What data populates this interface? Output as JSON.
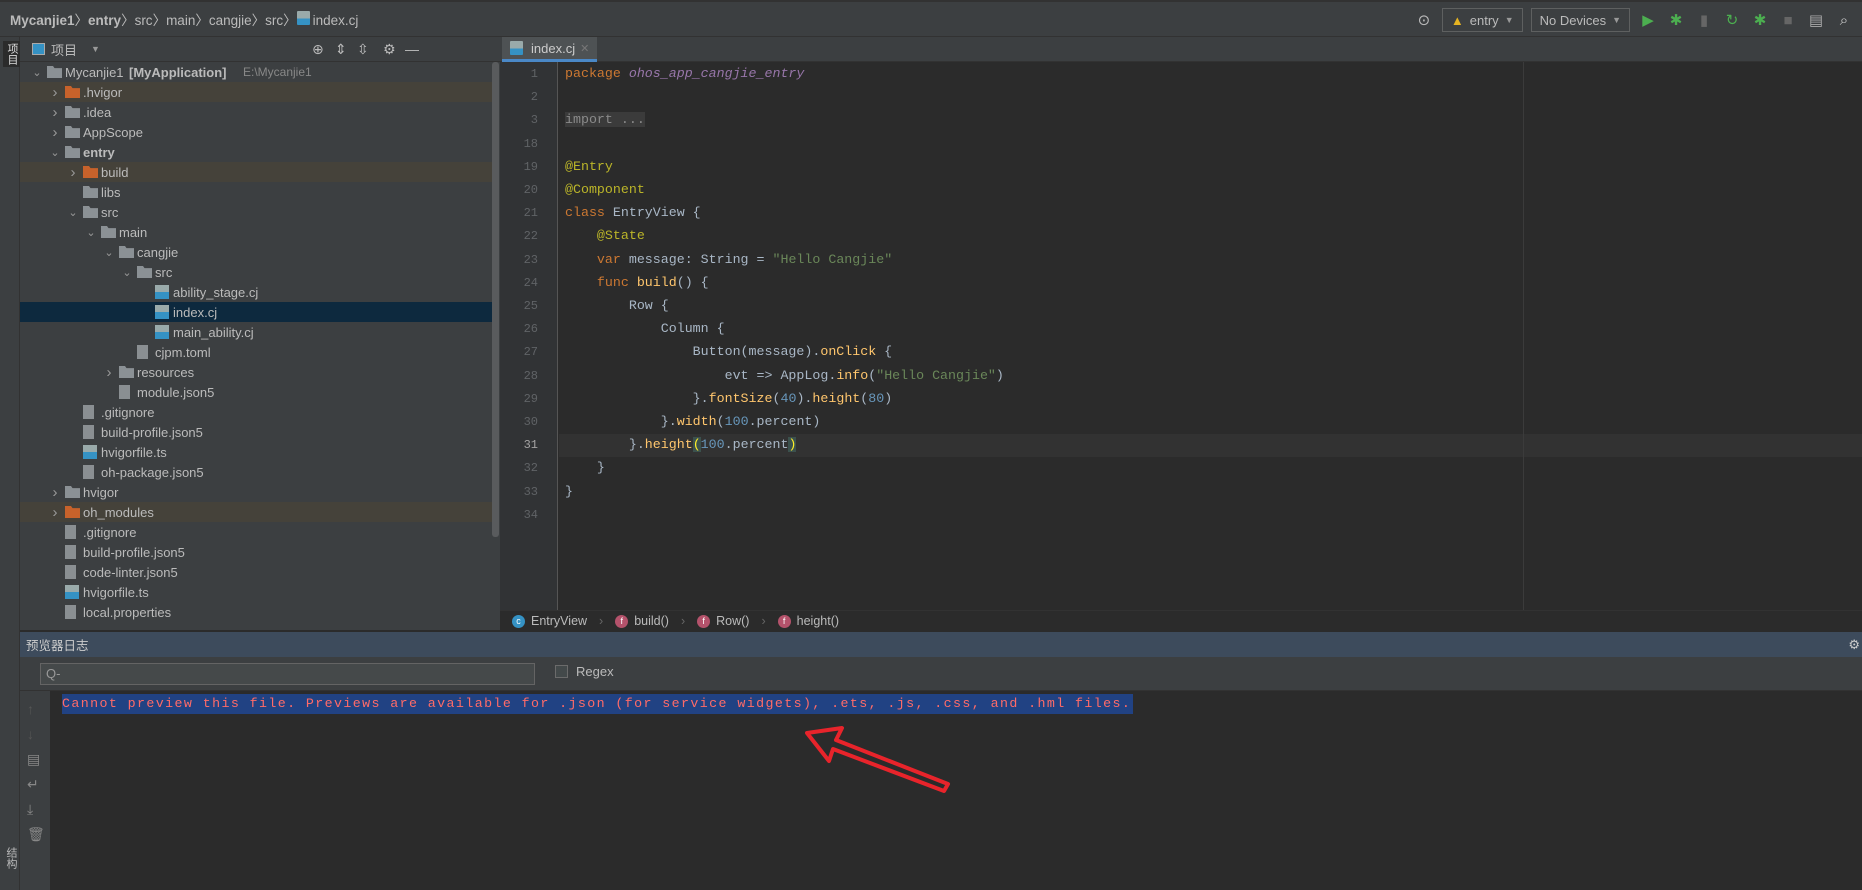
{
  "breadcrumb": [
    "Mycanjie1",
    "entry",
    "src",
    "main",
    "cangjie",
    "src",
    "index.cj"
  ],
  "toolbar": {
    "config": "entry",
    "devices": "No Devices"
  },
  "leftstrip": {
    "project": "项目",
    "structure": "结构"
  },
  "project_panel": {
    "title": "项目"
  },
  "tree": [
    {
      "label": "Mycanjie1",
      "bold": "[MyApplication]",
      "path": "E:\\Mycanjie1",
      "level": 0,
      "type": "module",
      "expanded": true
    },
    {
      "label": ".hvigor",
      "level": 1,
      "type": "folder-orange",
      "expanded": false,
      "excluded": true
    },
    {
      "label": ".idea",
      "level": 1,
      "type": "folder",
      "expanded": false
    },
    {
      "label": "AppScope",
      "level": 1,
      "type": "folder",
      "expanded": false
    },
    {
      "label": "entry",
      "level": 1,
      "type": "module",
      "expanded": true,
      "boldlabel": true
    },
    {
      "label": "build",
      "level": 2,
      "type": "folder-orange",
      "expanded": false,
      "excluded": true
    },
    {
      "label": "libs",
      "level": 2,
      "type": "folder"
    },
    {
      "label": "src",
      "level": 2,
      "type": "folder",
      "expanded": true
    },
    {
      "label": "main",
      "level": 3,
      "type": "folder",
      "expanded": true
    },
    {
      "label": "cangjie",
      "level": 4,
      "type": "folder",
      "expanded": true
    },
    {
      "label": "src",
      "level": 5,
      "type": "folder",
      "expanded": true
    },
    {
      "label": "ability_stage.cj",
      "level": 6,
      "type": "cj"
    },
    {
      "label": "index.cj",
      "level": 6,
      "type": "cj",
      "selected": true
    },
    {
      "label": "main_ability.cj",
      "level": 6,
      "type": "cj"
    },
    {
      "label": "cjpm.toml",
      "level": 5,
      "type": "file"
    },
    {
      "label": "resources",
      "level": 4,
      "type": "folder",
      "expanded": false
    },
    {
      "label": "module.json5",
      "level": 4,
      "type": "file"
    },
    {
      "label": ".gitignore",
      "level": 2,
      "type": "file"
    },
    {
      "label": "build-profile.json5",
      "level": 2,
      "type": "file"
    },
    {
      "label": "hvigorfile.ts",
      "level": 2,
      "type": "ts"
    },
    {
      "label": "oh-package.json5",
      "level": 2,
      "type": "file"
    },
    {
      "label": "hvigor",
      "level": 1,
      "type": "folder",
      "expanded": false
    },
    {
      "label": "oh_modules",
      "level": 1,
      "type": "folder-orange",
      "expanded": false,
      "excluded": true
    },
    {
      "label": ".gitignore",
      "level": 1,
      "type": "file"
    },
    {
      "label": "build-profile.json5",
      "level": 1,
      "type": "file"
    },
    {
      "label": "code-linter.json5",
      "level": 1,
      "type": "file"
    },
    {
      "label": "hvigorfile.ts",
      "level": 1,
      "type": "ts"
    },
    {
      "label": "local.properties",
      "level": 1,
      "type": "file"
    }
  ],
  "editor": {
    "tab": "index.cj",
    "current_line": "31",
    "lines": [
      {
        "n": "1",
        "t": [
          [
            "package ",
            "kw"
          ],
          [
            "ohos_app_cangjie_entry",
            "pk"
          ]
        ]
      },
      {
        "n": "2",
        "t": []
      },
      {
        "n": "3",
        "t": [
          [
            "import ...",
            "fold"
          ]
        ]
      },
      {
        "n": "18",
        "t": []
      },
      {
        "n": "19",
        "t": [
          [
            "@Entry",
            "an"
          ]
        ]
      },
      {
        "n": "20",
        "t": [
          [
            "@Component",
            "an"
          ]
        ]
      },
      {
        "n": "21",
        "t": [
          [
            "class ",
            "kw"
          ],
          [
            "EntryView {",
            ""
          ]
        ]
      },
      {
        "n": "22",
        "t": [
          [
            "    ",
            ""
          ],
          [
            "@State",
            "an"
          ]
        ]
      },
      {
        "n": "23",
        "t": [
          [
            "    ",
            ""
          ],
          [
            "var ",
            "kw"
          ],
          [
            "message: String = ",
            ""
          ],
          [
            "\"Hello Cangjie\"",
            "st"
          ]
        ]
      },
      {
        "n": "24",
        "t": [
          [
            "    ",
            ""
          ],
          [
            "func ",
            "kw"
          ],
          [
            "build",
            "fn"
          ],
          [
            "() {",
            ""
          ]
        ]
      },
      {
        "n": "25",
        "t": [
          [
            "        Row {",
            ""
          ]
        ]
      },
      {
        "n": "26",
        "t": [
          [
            "            Column {",
            ""
          ]
        ]
      },
      {
        "n": "27",
        "t": [
          [
            "                Button(message).",
            ""
          ],
          [
            "onClick",
            "fn"
          ],
          [
            " {",
            ""
          ]
        ]
      },
      {
        "n": "28",
        "t": [
          [
            "                    evt => AppLog.",
            ""
          ],
          [
            "info",
            "fn"
          ],
          [
            "(",
            ""
          ],
          [
            "\"Hello Cangjie\"",
            "st"
          ],
          [
            ")",
            ""
          ]
        ]
      },
      {
        "n": "29",
        "t": [
          [
            "                }.",
            ""
          ],
          [
            "fontSize",
            "fn"
          ],
          [
            "(",
            ""
          ],
          [
            "40",
            "nu"
          ],
          [
            ").",
            ""
          ],
          [
            "height",
            "fn"
          ],
          [
            "(",
            ""
          ],
          [
            "80",
            "nu"
          ],
          [
            ")",
            ""
          ]
        ]
      },
      {
        "n": "30",
        "t": [
          [
            "            }.",
            ""
          ],
          [
            "width",
            "fn"
          ],
          [
            "(",
            ""
          ],
          [
            "100",
            "nu"
          ],
          [
            ".percent)",
            ""
          ]
        ]
      },
      {
        "n": "31",
        "t": [
          [
            "        }.",
            ""
          ],
          [
            "height",
            "fn"
          ],
          [
            "(",
            "br"
          ],
          [
            "100",
            "nu"
          ],
          [
            ".percent",
            ""
          ],
          [
            ")",
            "br"
          ]
        ]
      },
      {
        "n": "32",
        "t": [
          [
            "    }",
            ""
          ]
        ]
      },
      {
        "n": "33",
        "t": [
          [
            "}",
            ""
          ]
        ]
      },
      {
        "n": "34",
        "t": []
      }
    ],
    "crumbs": [
      {
        "label": "EntryView",
        "kind": "c"
      },
      {
        "label": "build()",
        "kind": "f"
      },
      {
        "label": "Row()",
        "kind": "f"
      },
      {
        "label": "height()",
        "kind": "f"
      }
    ]
  },
  "log_panel": {
    "title": "预览器日志",
    "search_placeholder": "Q-",
    "regex_label": "Regex",
    "message": "Cannot preview this file. Previews are available for .json (for service widgets), .ets, .js, .css, and .hml files."
  },
  "colors": {
    "accent": "#4a88c7",
    "selection": "#214283",
    "error_text": "#ff6b68",
    "annotation_arrow": "#e8242b"
  }
}
